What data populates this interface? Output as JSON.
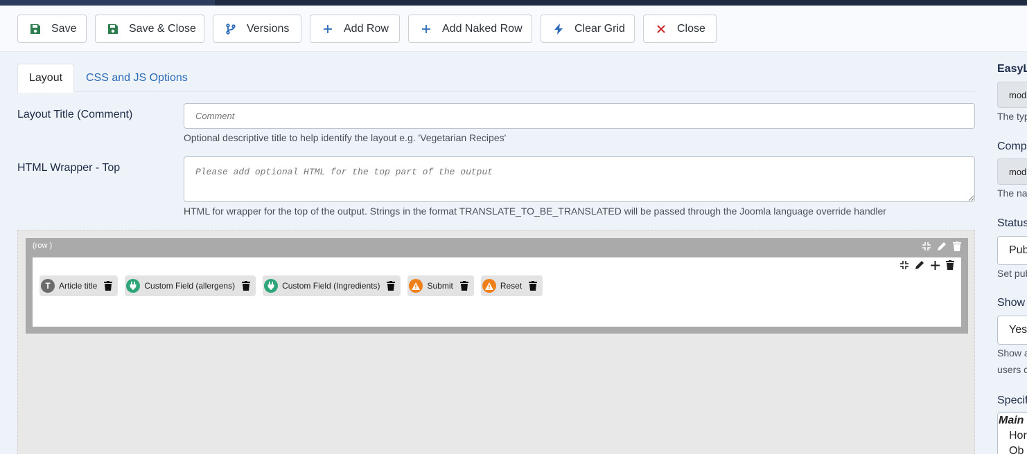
{
  "toolbar": {
    "buttons": [
      {
        "label": "Save",
        "icon": "save-icon"
      },
      {
        "label": "Save & Close",
        "icon": "save-icon"
      },
      {
        "label": "Versions",
        "icon": "branch-icon"
      },
      {
        "label": "Add Row",
        "icon": "plus-icon"
      },
      {
        "label": "Add Naked Row",
        "icon": "plus-icon"
      },
      {
        "label": "Clear Grid",
        "icon": "bolt-icon"
      },
      {
        "label": "Close",
        "icon": "close-icon"
      }
    ]
  },
  "tabs": [
    {
      "label": "Layout",
      "active": true
    },
    {
      "label": "CSS and JS Options",
      "active": false
    }
  ],
  "form": {
    "layout_title": {
      "label": "Layout Title (Comment)",
      "placeholder": "Comment",
      "help": "Optional descriptive title to help identify the layout e.g. 'Vegetarian Recipes'"
    },
    "html_wrapper_top": {
      "label": "HTML Wrapper - Top",
      "placeholder": "Please add optional HTML for the top part of the output",
      "help": "HTML for wrapper for the top of the output. Strings in the format TRANSLATE_TO_BE_TRANSLATED will be passed through the Joomla language override handler"
    }
  },
  "grid": {
    "row_label": "(row )",
    "fields": [
      {
        "label": "Article title",
        "badge": "T",
        "badge_color": "#6b6b6b",
        "icon": "text-icon"
      },
      {
        "label": "Custom Field (allergens)",
        "badge": "",
        "badge_color": "#2fa67a",
        "icon": "plug-icon"
      },
      {
        "label": "Custom Field (Ingredients)",
        "badge": "",
        "badge_color": "#2fa67a",
        "icon": "plug-icon"
      },
      {
        "label": "Submit",
        "badge": "",
        "badge_color": "#ee7f1b",
        "icon": "warning-icon"
      },
      {
        "label": "Reset",
        "badge": "",
        "badge_color": "#ee7f1b",
        "icon": "warning-icon"
      }
    ]
  },
  "sidebar": {
    "section_title": "EasyL",
    "type_button": "mod",
    "type_help": "The typ",
    "component_label": "Comp",
    "component_button": "mod",
    "component_help": "The na",
    "status_label": "Status",
    "status_value": "Pub",
    "status_help": "Set pub",
    "show_label": "Show",
    "show_value": "Yes",
    "show_help_1": "Show a",
    "show_help_2": "users c",
    "specific_label": "Specifi",
    "specific_group": "Main I",
    "specific_options": [
      "Hor",
      "Ob"
    ]
  },
  "colors": {
    "accent_link": "#2a69b8",
    "save_green": "#2e7d4f",
    "close_red": "#c62828",
    "topbar": "#1f2b42"
  }
}
